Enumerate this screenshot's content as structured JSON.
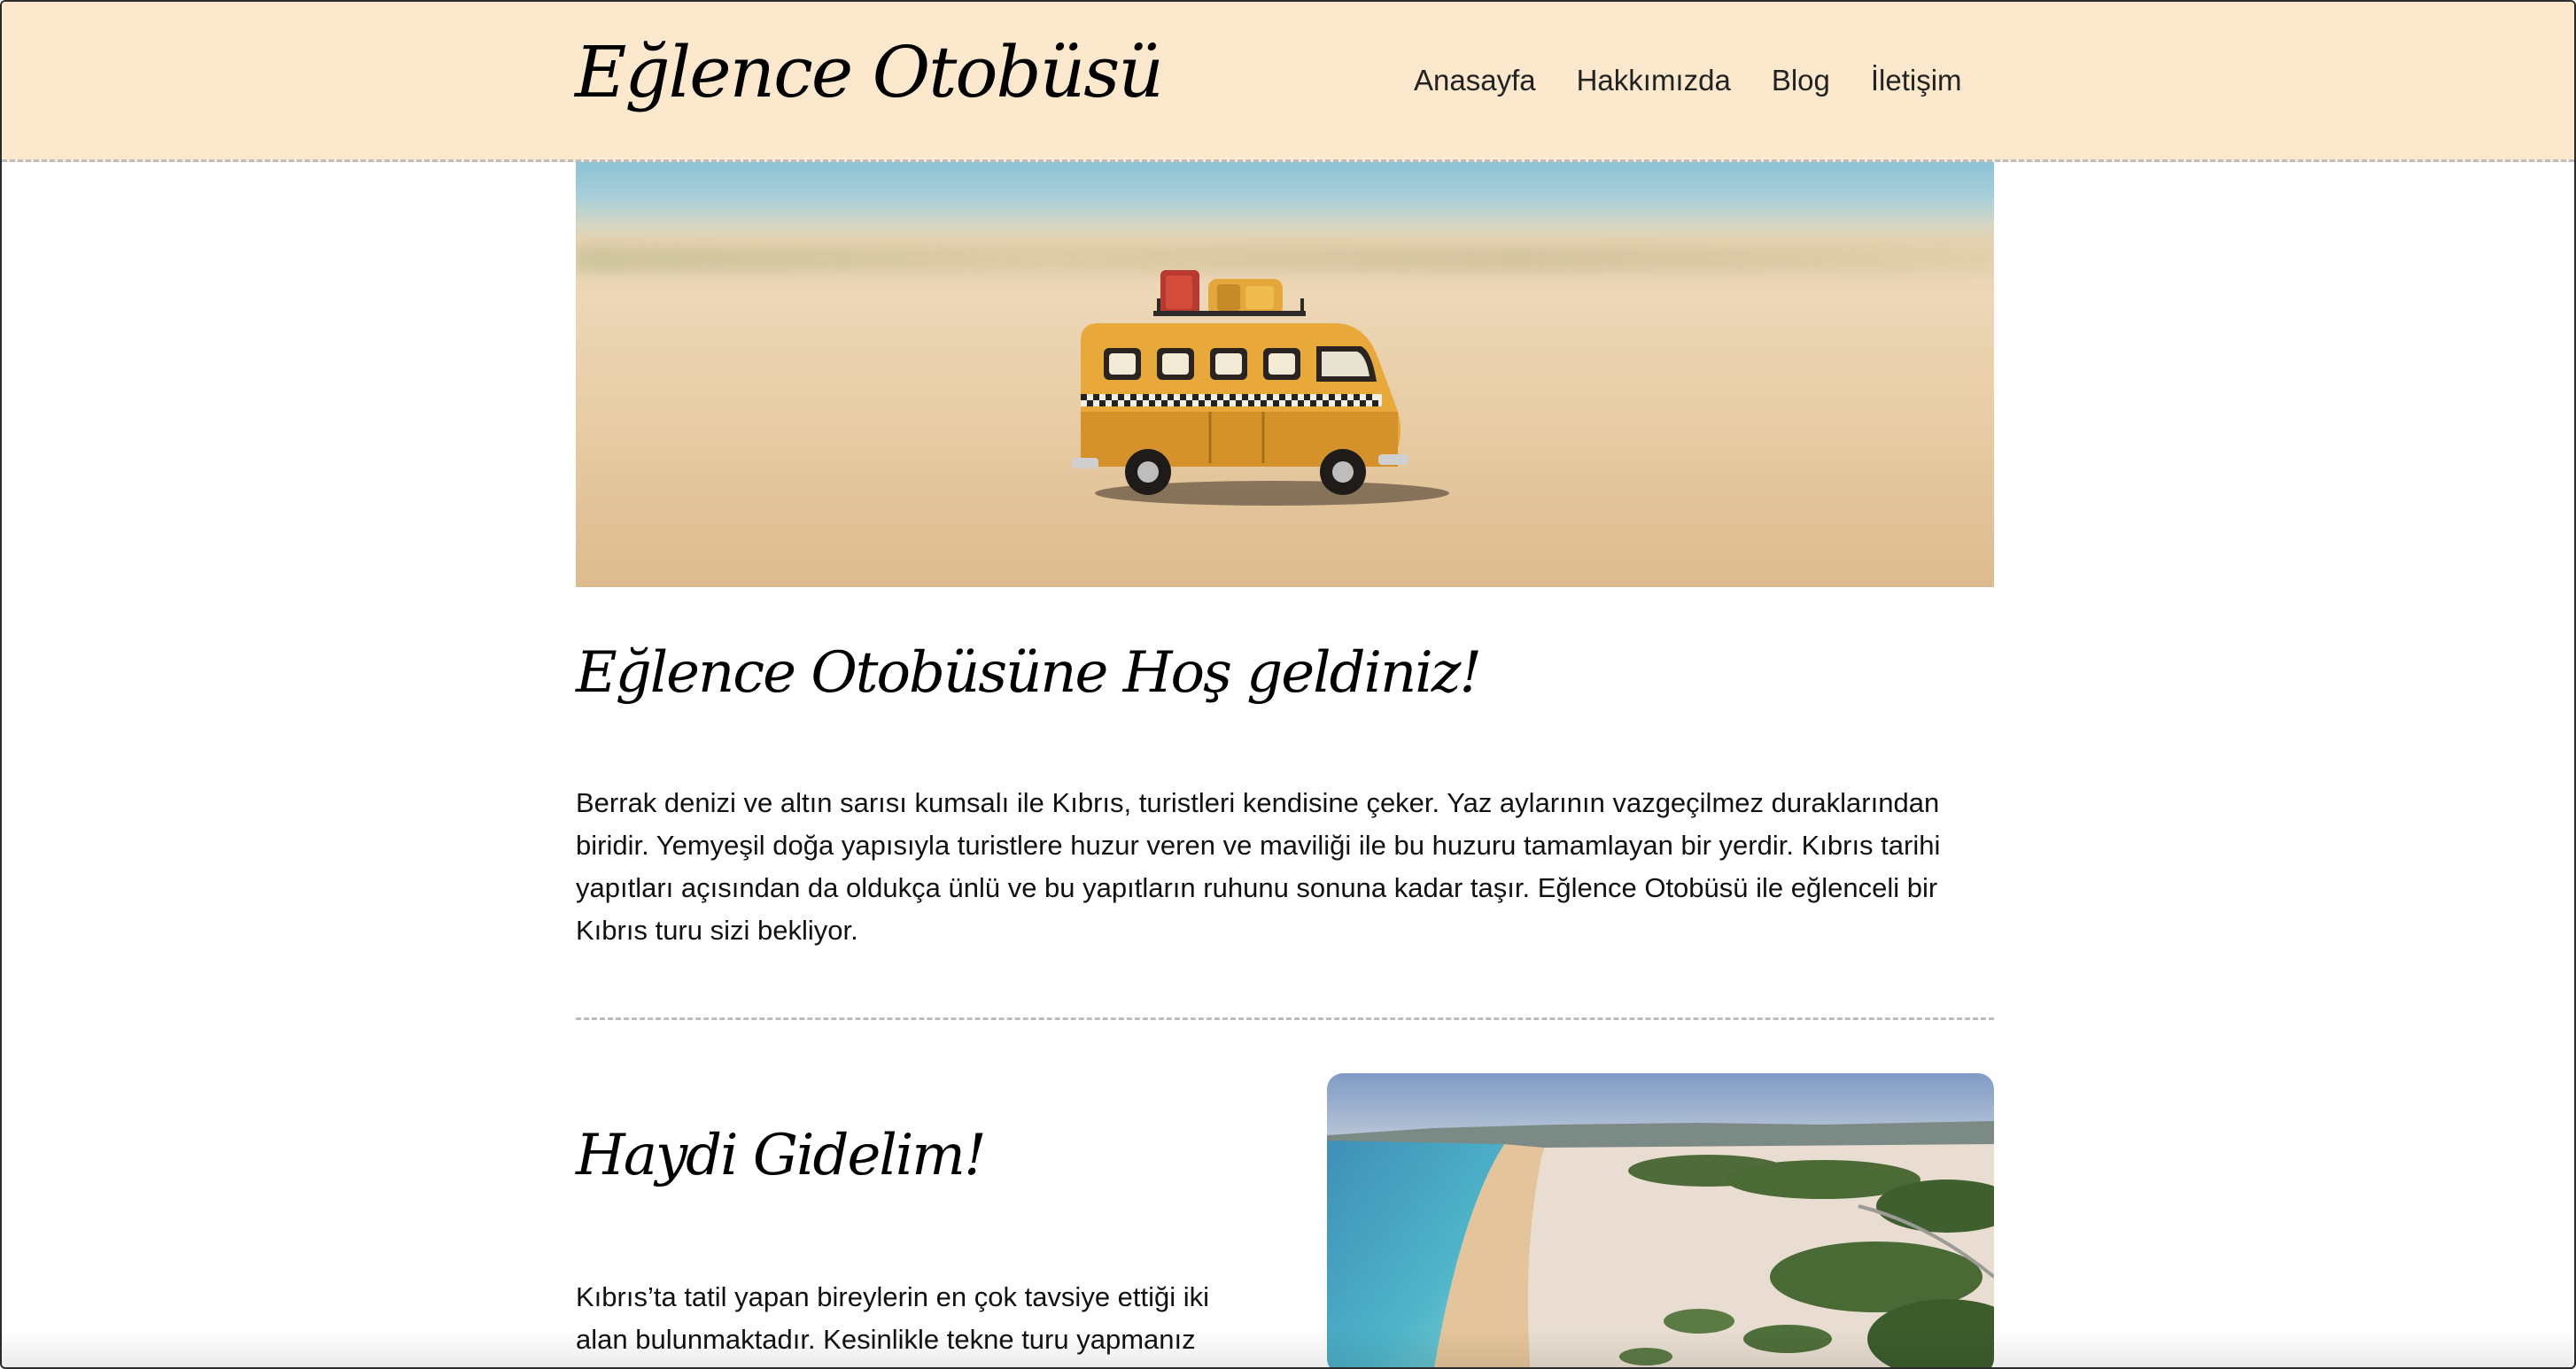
{
  "site": {
    "logo": "Eğlence Otobüsü"
  },
  "nav": {
    "items": [
      {
        "label": "Anasayfa"
      },
      {
        "label": "Hakkımızda"
      },
      {
        "label": "Blog"
      },
      {
        "label": "İletişim"
      }
    ]
  },
  "hero": {
    "image_subject": "toy yellow bus on sand"
  },
  "welcome": {
    "title": "Eğlence Otobüsüne Hoş geldiniz!",
    "text": "Berrak denizi ve altın sarısı kumsalı ile Kıbrıs, turistleri kendisine çeker. Yaz aylarının vazgeçilmez duraklarından biridir. Yemyeşil doğa yapısıyla turistlere huzur veren ve maviliği ile bu huzuru tamamlayan bir yerdir. Kıbrıs tarihi yapıtları açısından da oldukça ünlü ve bu yapıtların ruhunu sonuna kadar taşır. Eğlence Otobüsü ile eğlenceli bir Kıbrıs turu sizi bekliyor."
  },
  "section": {
    "title": "Haydi Gidelim!",
    "text": "Kıbrıs’ta tatil yapan bireylerin en çok tavsiye ettiği iki alan bulunmaktadır. Kesinlikle tekne turu yapmanız",
    "image_subject": "aerial beach coastline"
  },
  "colors": {
    "header_bg": "#fce9cd",
    "divider": "#bdbdbd",
    "text": "#111111"
  }
}
